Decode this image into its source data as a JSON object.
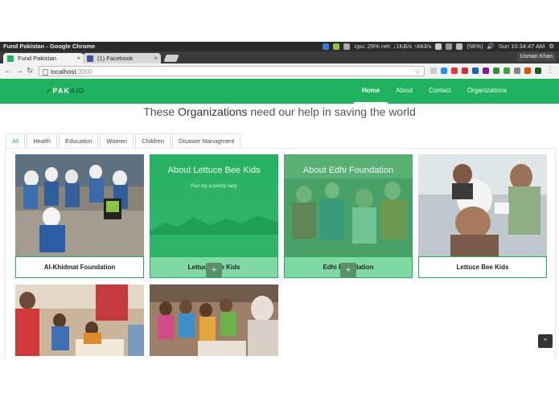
{
  "os": {
    "window_title": "Fund Pakistan - Google Chrome",
    "cpu": "cpu: 29% net: ↓1KB/s ↑843/s",
    "battery": "(56%)",
    "clock": "Sun 10:34:47 AM"
  },
  "tabs": [
    {
      "label": "Fund Pakistan"
    },
    {
      "label": "(1) Facebook"
    }
  ],
  "user_chip": "Usman Khan",
  "address": {
    "host": "localhost",
    "port": ":3000"
  },
  "site": {
    "logo_prefix": "PAK",
    "logo_suffix": "AID",
    "nav": [
      "Home",
      "About",
      "Contact",
      "Organizations"
    ],
    "headline_pre": "These",
    "headline_bold": "Organizations",
    "headline_post": "need our help in saving the world",
    "filters": [
      "All",
      "Health",
      "Education",
      "Women",
      "Children",
      "Disaster Managment"
    ]
  },
  "cards": [
    {
      "name": "Al-Khidmat Foundation"
    },
    {
      "name": "Lettuce Bee Kids",
      "overlay_title": "About Lettuce Bee Kids",
      "overlay_sub": "Ran by a pretty lady",
      "plus": "+"
    },
    {
      "name": "Edhi Foundation",
      "overlay_title": "About Edhi Foundation",
      "plus": "+"
    },
    {
      "name": "Lettuce Bee Kids"
    }
  ],
  "to_top": "^",
  "colors": {
    "brand": "#1fb35f",
    "overlay": "#7fd9a3"
  }
}
